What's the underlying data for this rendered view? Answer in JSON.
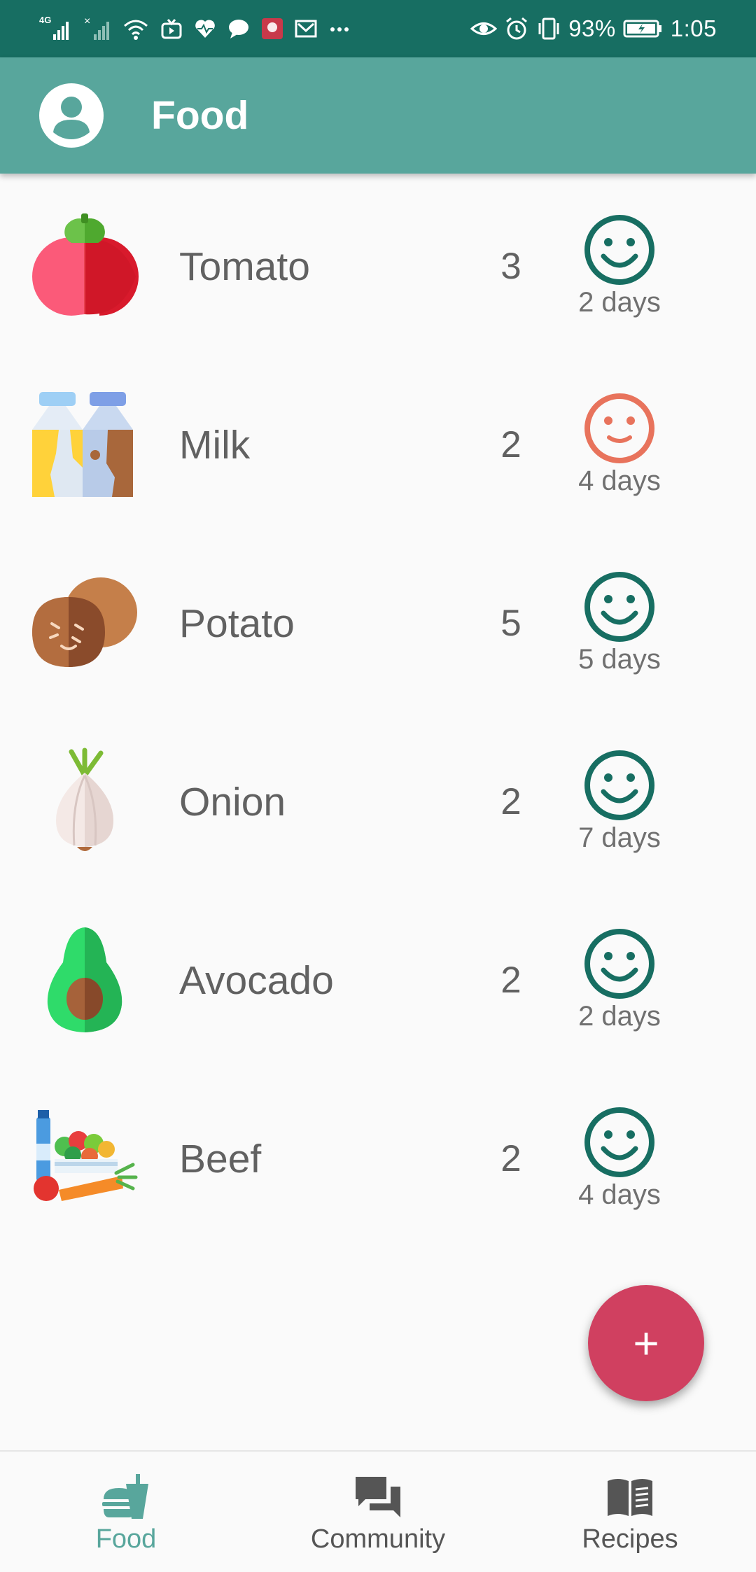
{
  "status_bar": {
    "network": "4G",
    "battery": "93%",
    "time": "1:05",
    "icons": [
      "signal-icon",
      "no-signal-icon",
      "wifi-icon",
      "tv-icon",
      "health-icon",
      "chat-icon",
      "app-icon",
      "mail-icon",
      "more-icon",
      "eye-icon",
      "alarm-icon",
      "vibrate-icon",
      "battery-icon"
    ]
  },
  "app_bar": {
    "title": "Food",
    "avatar_icon": "account-circle-icon"
  },
  "colors": {
    "primary": "#58a69c",
    "status_bar": "#176e62",
    "good": "#176e62",
    "warning": "#e8735c",
    "fab": "#d04060",
    "nav_active": "#58a69c",
    "nav_inactive": "#555555"
  },
  "items": [
    {
      "name": "Tomato",
      "quantity": "3",
      "days": "2 days",
      "status": "good",
      "icon": "tomato-icon"
    },
    {
      "name": "Milk",
      "quantity": "2",
      "days": "4 days",
      "status": "warning",
      "icon": "milk-icon"
    },
    {
      "name": "Potato",
      "quantity": "5",
      "days": "5 days",
      "status": "good",
      "icon": "potato-icon"
    },
    {
      "name": "Onion",
      "quantity": "2",
      "days": "7 days",
      "status": "good",
      "icon": "onion-icon"
    },
    {
      "name": "Avocado",
      "quantity": "2",
      "days": "2 days",
      "status": "good",
      "icon": "avocado-icon"
    },
    {
      "name": "Beef",
      "quantity": "2",
      "days": "4 days",
      "status": "good",
      "icon": "groceries-icon"
    }
  ],
  "fab": {
    "label": "+",
    "icon": "plus-icon"
  },
  "bottom_nav": [
    {
      "label": "Food",
      "icon": "food-icon",
      "active": true
    },
    {
      "label": "Community",
      "icon": "community-icon",
      "active": false
    },
    {
      "label": "Recipes",
      "icon": "recipes-icon",
      "active": false
    }
  ]
}
